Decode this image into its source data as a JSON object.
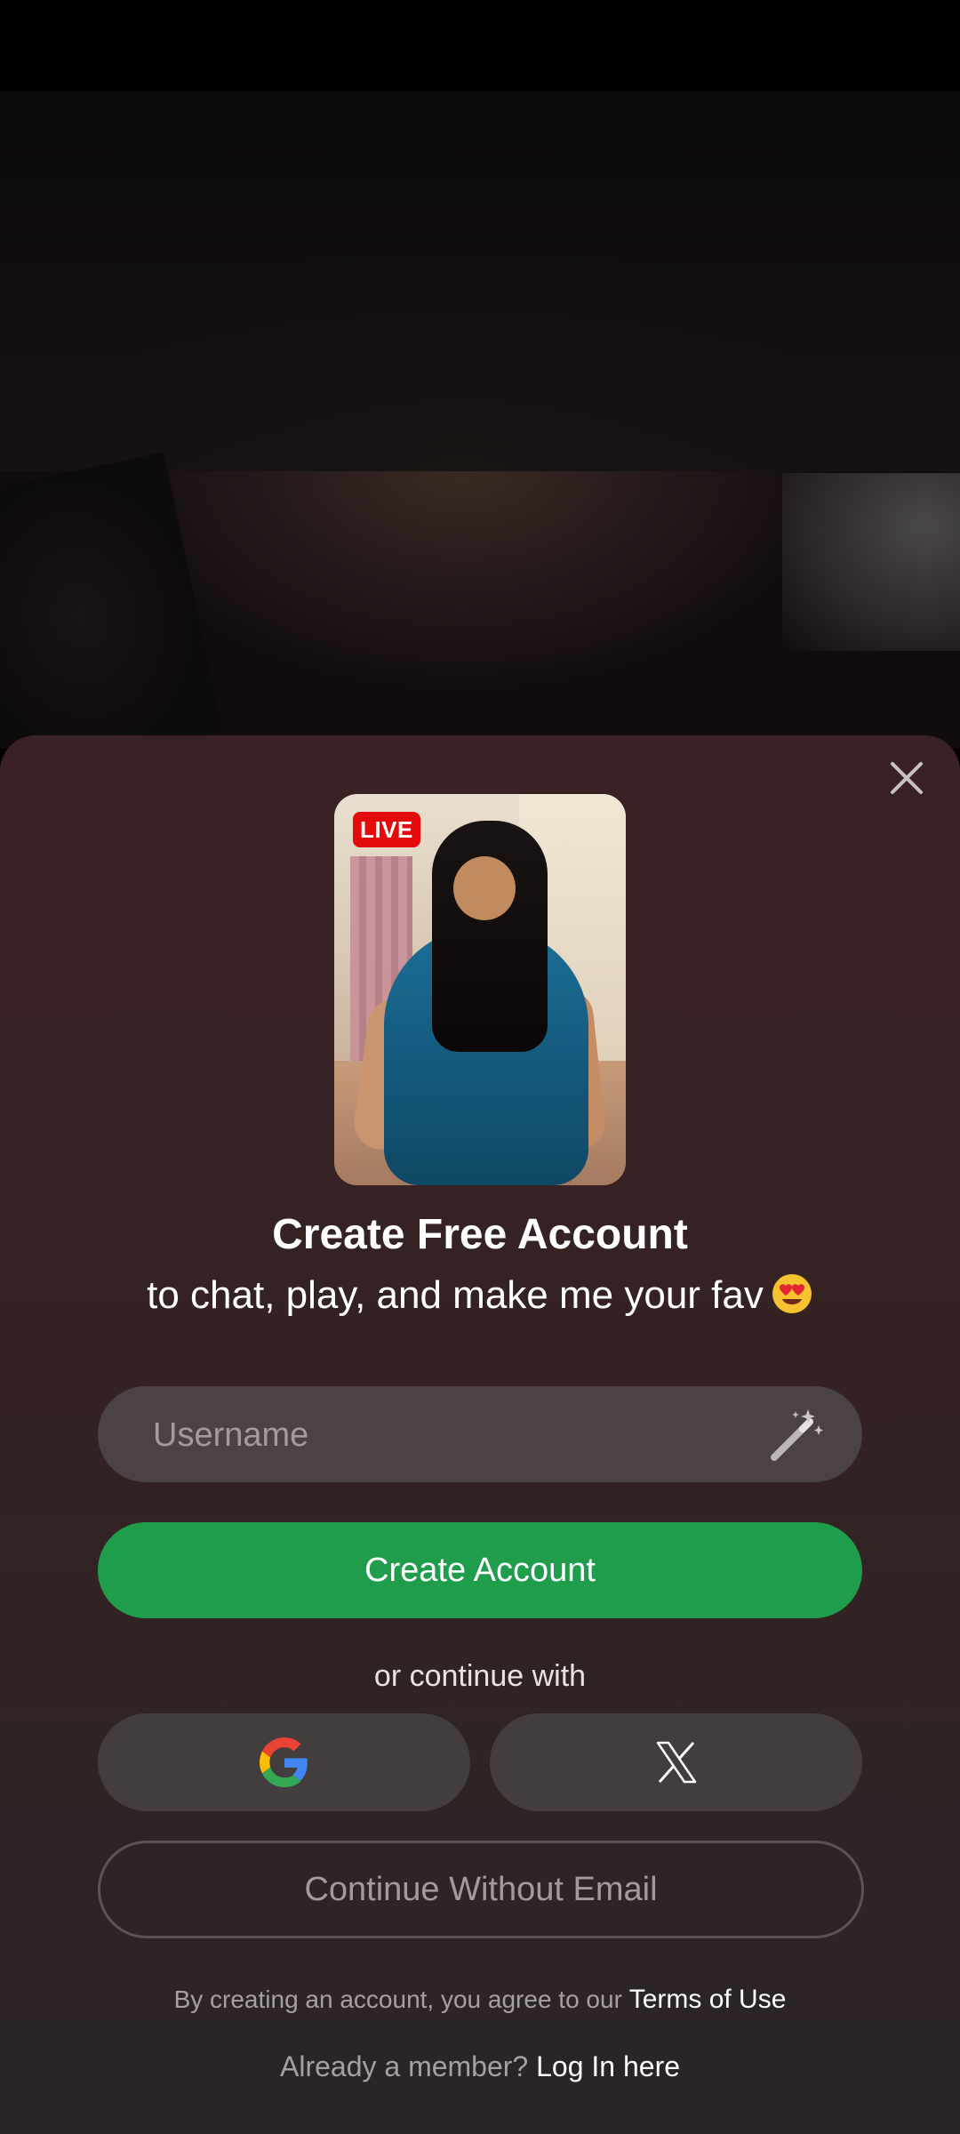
{
  "preview": {
    "live_badge": "LIVE"
  },
  "modal": {
    "title": "Create Free Account",
    "subtitle": "to chat, play, and make me your fav",
    "username_placeholder": "Username",
    "create_button": "Create Account",
    "or_text": "or continue with",
    "continue_without_email": "Continue Without Email",
    "terms_prefix": "By creating an account, you agree to our",
    "terms_link": "Terms of Use",
    "login_prefix": "Already a member?",
    "login_link": "Log In here"
  },
  "icons": {
    "close": "close-icon",
    "wand": "magic-wand-icon",
    "google": "google-icon",
    "x": "x-logo-icon",
    "emoji": "heart-eyes-emoji"
  },
  "colors": {
    "primary": "#1f9d4d",
    "live": "#e30b0b",
    "sheet_top": "#3a2124",
    "sheet_bottom": "#2a2526"
  }
}
